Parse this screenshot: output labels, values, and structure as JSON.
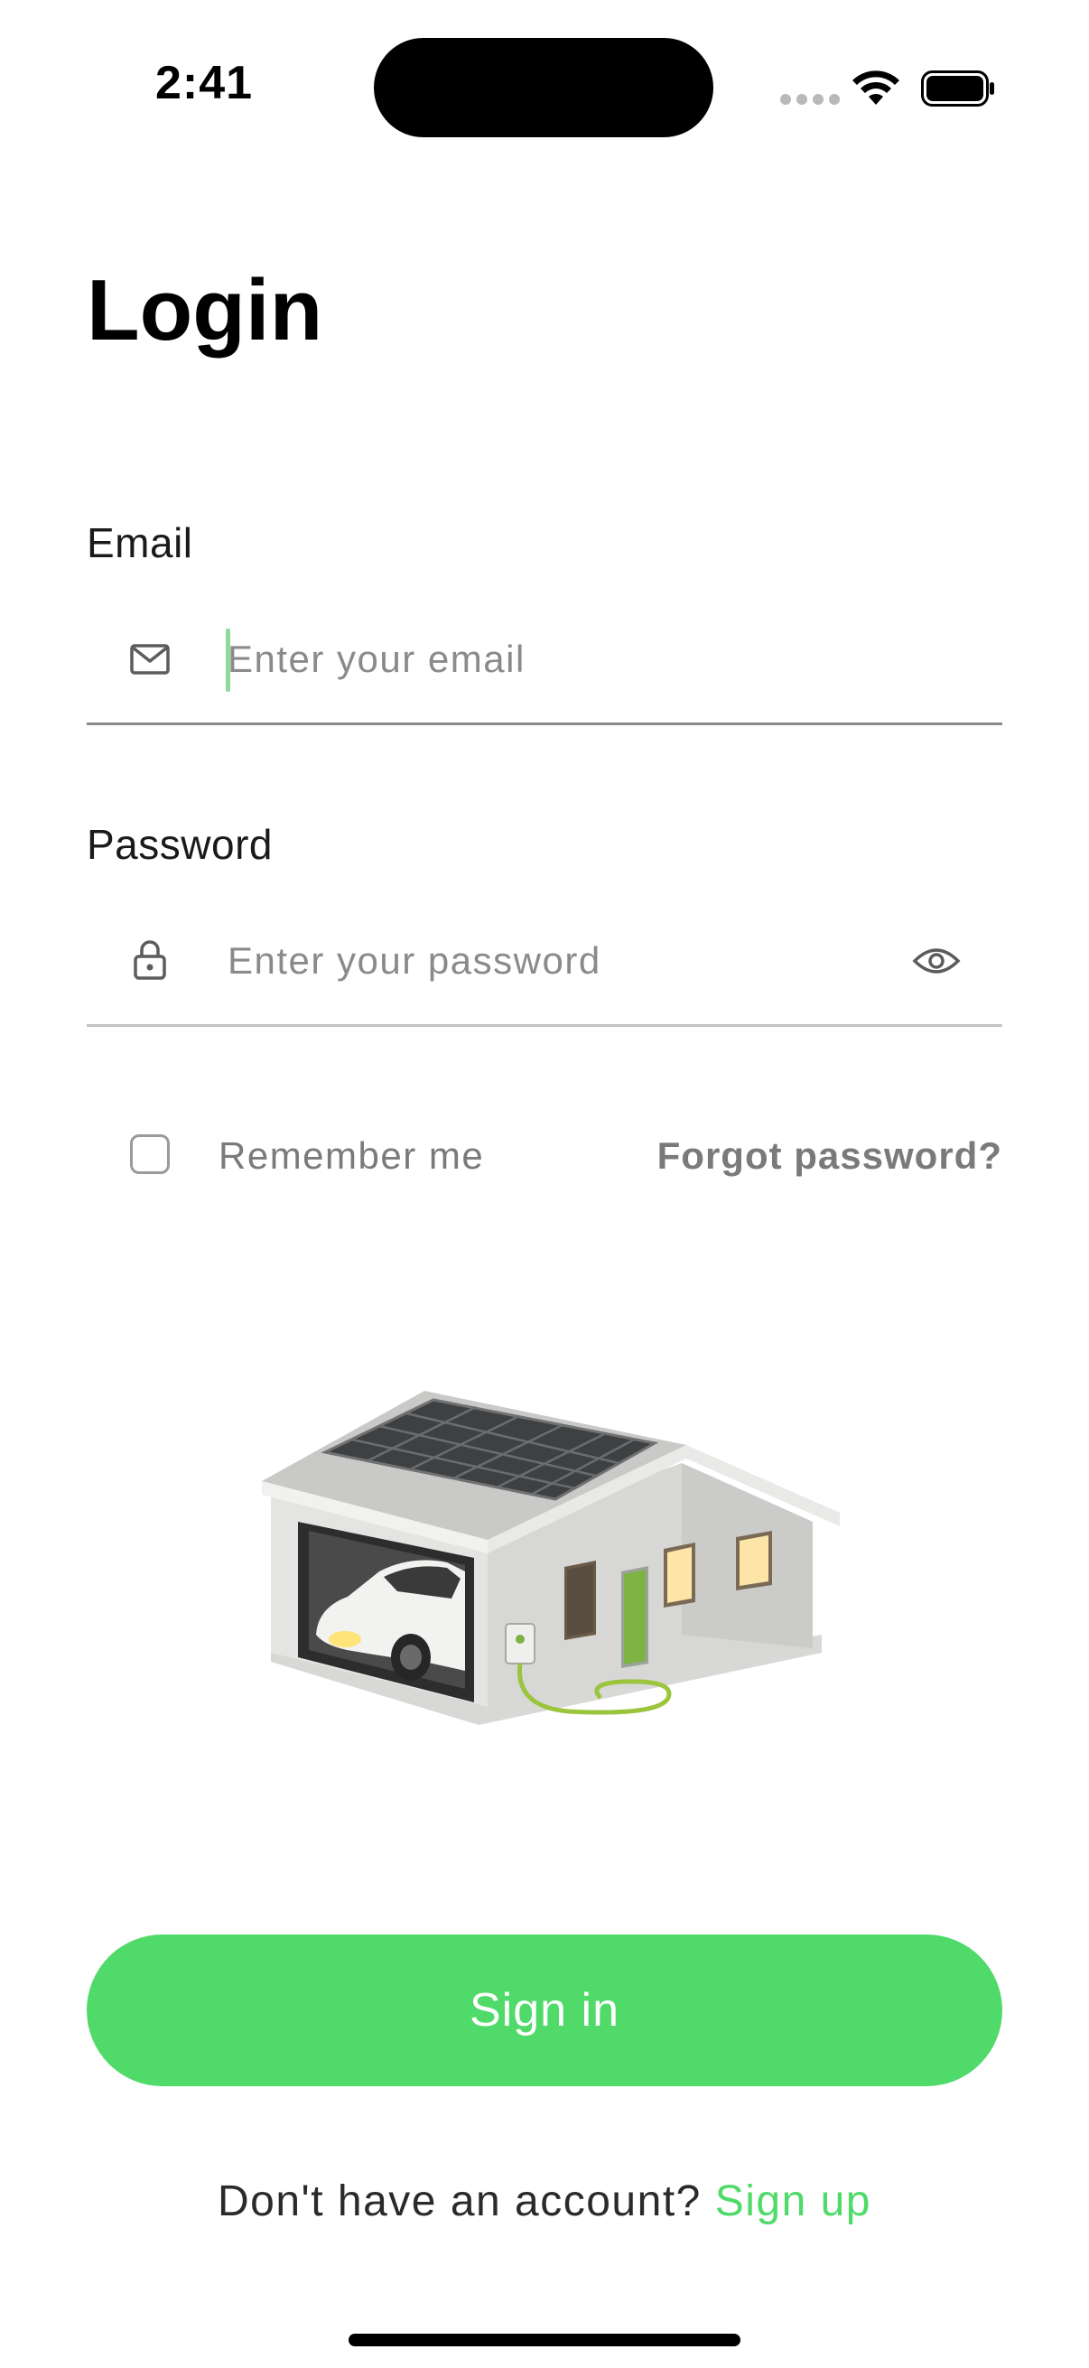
{
  "status_bar": {
    "time": "2:41",
    "icons": [
      "signal-dots-icon",
      "wifi-icon",
      "battery-icon"
    ]
  },
  "page": {
    "title": "Login"
  },
  "email": {
    "label": "Email",
    "placeholder": "Enter your email",
    "value": "",
    "icon": "mail-icon"
  },
  "password": {
    "label": "Password",
    "placeholder": "Enter your password",
    "value": "",
    "icon": "lock-icon",
    "toggle_icon": "eye-icon"
  },
  "remember": {
    "label": "Remember me",
    "checked": false
  },
  "forgot": {
    "label": "Forgot password?"
  },
  "illustration": {
    "name": "solar-house-ev-charging-illustration"
  },
  "sign_in": {
    "label": "Sign in"
  },
  "signup": {
    "prompt": "Don't have an account?",
    "link_label": "Sign up"
  },
  "colors": {
    "accent": "#4fda69",
    "muted_text": "#7a7a7a",
    "caret": "#8fd99a"
  }
}
